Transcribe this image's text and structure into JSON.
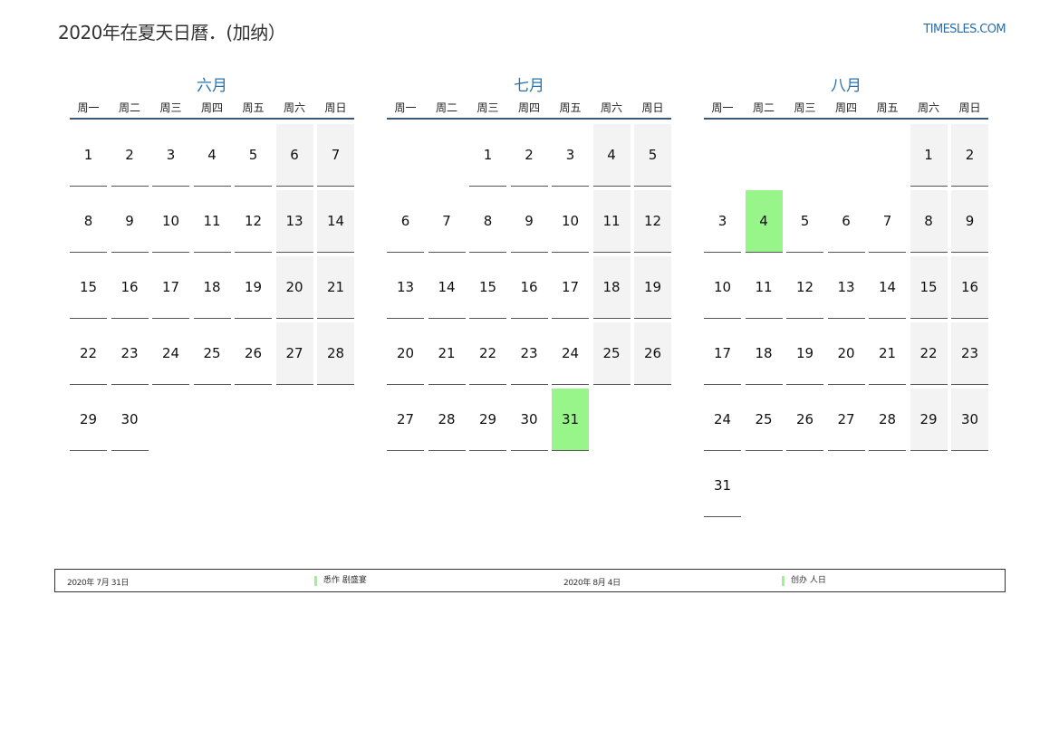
{
  "header": {
    "title": "2020年在夏天日曆．(加纳）",
    "site": "TIMESLES.COM"
  },
  "colors": {
    "holiday": "#98f58a",
    "weekend": "#f3f3f3",
    "accent": "#2a73ad"
  },
  "weekdays": [
    "周一",
    "周二",
    "周三",
    "周四",
    "周五",
    "周六",
    "周日"
  ],
  "months": [
    {
      "name": "六月",
      "days": [
        "1",
        "2",
        "3",
        "4",
        "5",
        "6",
        "7",
        "8",
        "9",
        "10",
        "11",
        "12",
        "13",
        "14",
        "15",
        "16",
        "17",
        "18",
        "19",
        "20",
        "21",
        "22",
        "23",
        "24",
        "25",
        "26",
        "27",
        "28",
        "29",
        "30"
      ]
    },
    {
      "name": "七月",
      "days": [
        "",
        "",
        "1",
        "2",
        "3",
        "4",
        "5",
        "6",
        "7",
        "8",
        "9",
        "10",
        "11",
        "12",
        "13",
        "14",
        "15",
        "16",
        "17",
        "18",
        "19",
        "20",
        "21",
        "22",
        "23",
        "24",
        "25",
        "26",
        "27",
        "28",
        "29",
        "30",
        "31"
      ]
    },
    {
      "name": "八月",
      "days": [
        "",
        "",
        "",
        "",
        "",
        "1",
        "2",
        "3",
        "4",
        "5",
        "6",
        "7",
        "8",
        "9",
        "10",
        "11",
        "12",
        "13",
        "14",
        "15",
        "16",
        "17",
        "18",
        "19",
        "20",
        "21",
        "22",
        "23",
        "24",
        "25",
        "26",
        "27",
        "28",
        "29",
        "30",
        "31"
      ]
    }
  ],
  "highlights": {
    "七月": [
      "31"
    ],
    "八月": [
      "4"
    ]
  },
  "legend": [
    {
      "date": "2020年 7月 31日",
      "name": "悉作 剧盛宴"
    },
    {
      "date": "2020年 8月 4日",
      "name": "创办 人日"
    }
  ]
}
